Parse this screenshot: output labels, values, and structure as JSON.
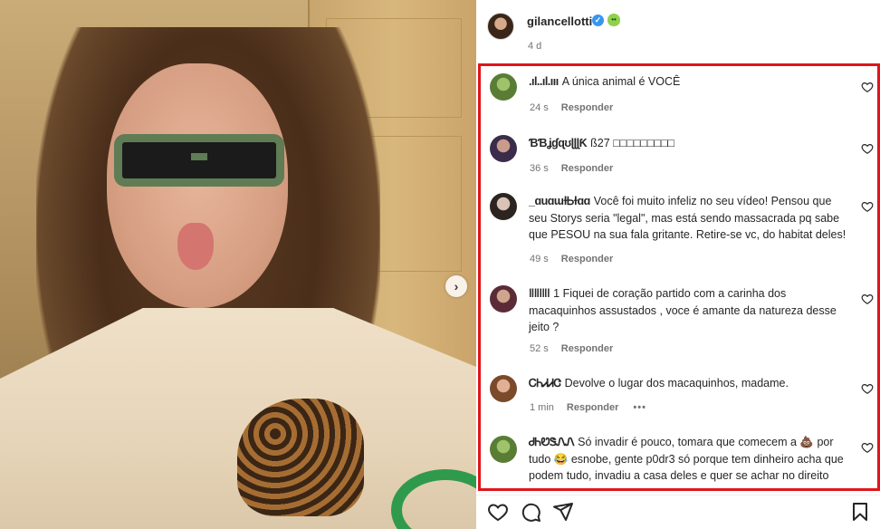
{
  "post": {
    "username": "gilancellotti",
    "age": "4 d",
    "verified_icon": "verified-badge-icon",
    "emoji_icon": "alien-emoji-icon",
    "next_glyph": "›"
  },
  "comments": [
    {
      "username": ".ıl..ıl.ııı",
      "text": "A única animal é VOCÊ",
      "time": "24 s",
      "reply": "Responder",
      "more": ""
    },
    {
      "username": "ƁƁʝɠɋʊɭɭɭƘ",
      "text": "ß27 □□□□□□□□□",
      "time": "36 s",
      "reply": "Responder",
      "more": ""
    },
    {
      "username": "_ɑuɑɯɫᏏɫɑɑ",
      "text": "Você foi muito infeliz no seu vídeo! Pensou que seu Storys seria \"legal\", mas está sendo massacrada pq sabe que PESOU na sua fala gritante. Retire-se vc, do habitat deles!",
      "time": "49 s",
      "reply": "Responder",
      "more": ""
    },
    {
      "username": "ǁǁǀǁǀ",
      "text": "1 Fiquei de coração partido com a carinha dos macaquinhos assustados , voce é amante da natureza desse jeito ?",
      "time": "52 s",
      "reply": "Responder",
      "more": ""
    },
    {
      "username": "ᏟᏂᏗᏗᏣ",
      "text": "Devolve o lugar dos macaquinhos, madame.",
      "time": "1 min",
      "reply": "Responder",
      "more": "•••"
    },
    {
      "username": "ᏧᏂᏬᏕᏁᏁ",
      "text": "Só invadir é pouco, tomara que comecem a 💩 por tudo 😂 esnobe, gente p0dr3 só porque tem dinheiro acha que podem tudo, invadiu a casa deles e quer se achar no direito",
      "time": "",
      "reply": "",
      "more": ""
    }
  ],
  "colors": {
    "highlight_border": "#e0151b",
    "verified": "#3797f0",
    "meta_text": "#737373"
  },
  "action_icons": [
    "heart-icon",
    "comment-icon",
    "share-icon",
    "bookmark-icon"
  ]
}
